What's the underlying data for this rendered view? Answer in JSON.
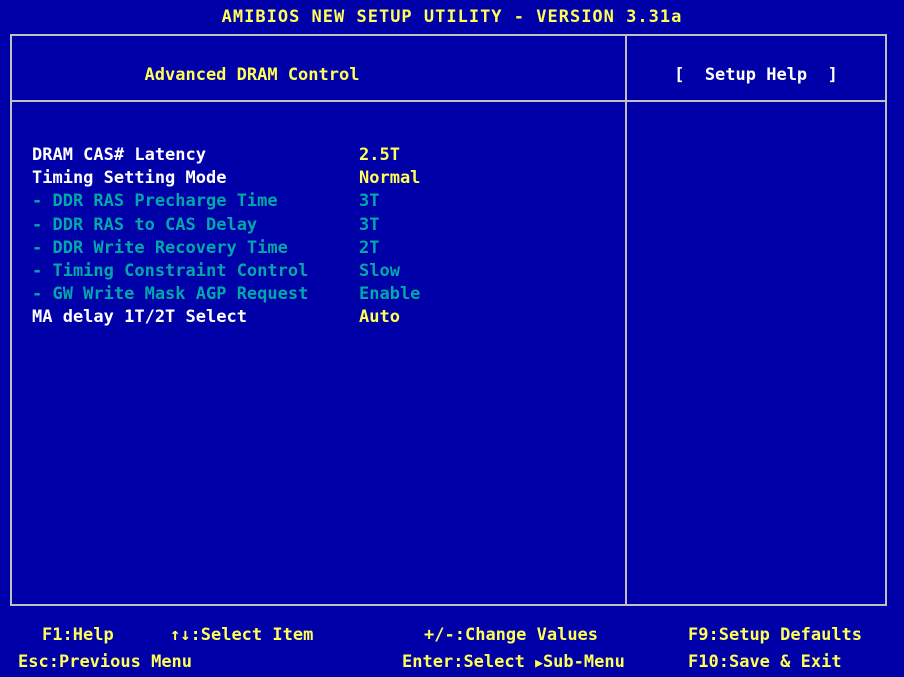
{
  "window": {
    "title": "AMIBIOS NEW SETUP UTILITY - VERSION 3.31a"
  },
  "page": {
    "title": "Advanced DRAM Control"
  },
  "help": {
    "title": "[  Setup Help  ]"
  },
  "colors": {
    "background": "#0000a8",
    "title_text": "#ffff55",
    "active_label": "#ffffff",
    "active_value": "#ffff55",
    "disabled_text": "#00a8a8",
    "border": "#c0c0c0"
  },
  "settings": [
    {
      "label": "DRAM CAS# Latency",
      "value": "2.5T",
      "state": "active"
    },
    {
      "label": "Timing Setting Mode",
      "value": "Normal",
      "state": "active"
    },
    {
      "label": "- DDR RAS Precharge Time",
      "value": "3T",
      "state": "disabled"
    },
    {
      "label": "- DDR RAS to CAS Delay",
      "value": "3T",
      "state": "disabled"
    },
    {
      "label": "- DDR Write Recovery Time",
      "value": "2T",
      "state": "disabled"
    },
    {
      "label": "- Timing Constraint Control",
      "value": "Slow",
      "state": "disabled"
    },
    {
      "label": "- GW Write Mask AGP Request",
      "value": "Enable",
      "state": "disabled"
    },
    {
      "label": "MA delay 1T/2T Select",
      "value": "Auto",
      "state": "active"
    }
  ],
  "footer": {
    "f1_key": "F1",
    "f1_desc": "Help",
    "arrows_key": "↑↓",
    "arrows_desc": "Select Item",
    "pm_key": "+/-",
    "pm_desc": "Change Values",
    "f9_key": "F9",
    "f9_desc": "Setup Defaults",
    "esc_key": "Esc",
    "esc_desc": "Previous Menu",
    "enter_key": "Enter",
    "enter_desc": "Select",
    "submenu_arrow_icon": "triangle-right-icon",
    "submenu_desc": "Sub-Menu",
    "f10_key": "F10",
    "f10_desc": "Save & Exit"
  }
}
